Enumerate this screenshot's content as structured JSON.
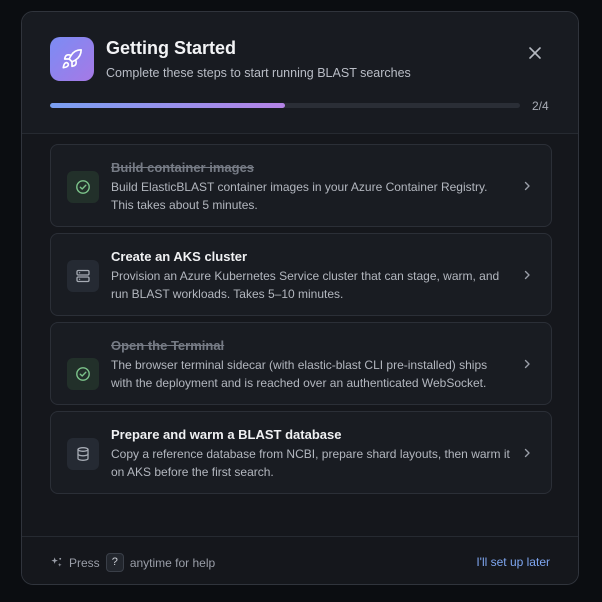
{
  "dialog": {
    "title": "Getting Started",
    "subtitle": "Complete these steps to start running BLAST searches",
    "app_icon": "rocket-icon",
    "close_icon": "close-icon",
    "progress": {
      "completed": 2,
      "total": 4,
      "label": "2/4",
      "fraction": 0.5
    }
  },
  "steps": [
    {
      "title": "Build container images",
      "description": "Build ElasticBLAST container images in your Azure Container Registry. This takes about 5 minutes.",
      "status": "done",
      "icon": "check-circle-icon"
    },
    {
      "title": "Create an AKS cluster",
      "description": "Provision an Azure Kubernetes Service cluster that can stage, warm, and run BLAST workloads. Takes 5–10 minutes.",
      "status": "todo",
      "icon": "server-icon"
    },
    {
      "title": "Open the Terminal",
      "description": "The browser terminal sidecar (with elastic-blast CLI pre-installed) ships with the deployment and is reached over an authenticated WebSocket.",
      "status": "done",
      "icon": "check-circle-icon"
    },
    {
      "title": "Prepare and warm a BLAST database",
      "description": "Copy a reference database from NCBI, prepare shard layouts, then warm it on AKS before the first search.",
      "status": "todo",
      "icon": "database-icon"
    }
  ],
  "footer": {
    "help_prefix": "Press",
    "help_key": "?",
    "help_suffix": "anytime for help",
    "help_icon": "sparkle-icon",
    "later_link": "I'll set up later"
  },
  "colors": {
    "accent_start": "#7aa0f2",
    "accent_end": "#b483e6",
    "done_green": "#7cc38a",
    "link_blue": "#7ea6f0"
  }
}
